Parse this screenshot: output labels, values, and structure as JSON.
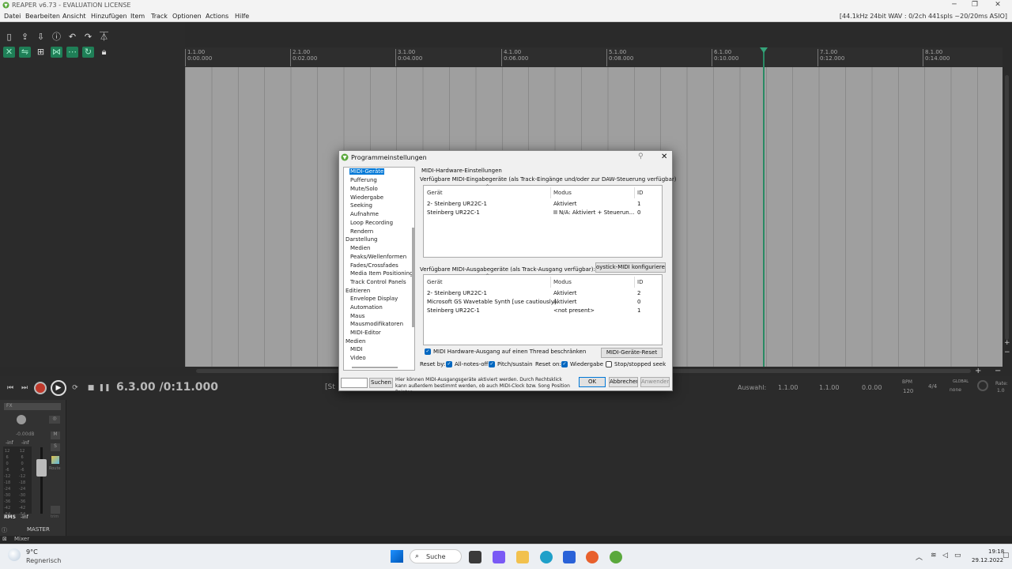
{
  "window": {
    "title": "REAPER v6.73 - EVALUATION LICENSE",
    "status": "[44.1kHz 24bit WAV : 0/2ch 441spls ~20/20ms ASIO]"
  },
  "menu": [
    "Datei",
    "Bearbeiten",
    "Ansicht",
    "Hinzufügen",
    "Item",
    "Track",
    "Optionen",
    "Actions",
    "Hilfe"
  ],
  "ruler": [
    {
      "bar": "1.1.00",
      "time": "0:00.000"
    },
    {
      "bar": "2.1.00",
      "time": "0:02.000"
    },
    {
      "bar": "3.1.00",
      "time": "0:04.000"
    },
    {
      "bar": "4.1.00",
      "time": "0:06.000"
    },
    {
      "bar": "5.1.00",
      "time": "0:08.000"
    },
    {
      "bar": "6.1.00",
      "time": "0:10.000"
    },
    {
      "bar": "7.1.00",
      "time": "0:12.000"
    },
    {
      "bar": "8.1.00",
      "time": "0:14.000"
    }
  ],
  "transport": {
    "position": "6.3.00 /0:11.000",
    "selection_label": "[St",
    "auswahl_label": "Auswahl:",
    "sel_start": "1.1.00",
    "sel_end": "1.1.00",
    "sel_len": "0.0.00",
    "bpm_label": "BPM",
    "bpm": "120",
    "sig": "4/4",
    "global_label": "GLOBAL",
    "global_value": "none",
    "rate_label": "Rate:",
    "rate": "1.0"
  },
  "master": {
    "fx": "FX",
    "vol": "-0.00dB",
    "peak_l": "-inf",
    "peak_r": "-inf",
    "rms": "RMS",
    "rms_val": "-inf",
    "m": "M",
    "s": "S",
    "route": "Route",
    "trim": "trim",
    "name": "MASTER",
    "scale": [
      "12",
      "6",
      "0",
      "-6",
      "-12",
      "-18",
      "-24",
      "-30",
      "-36",
      "-42",
      "-54"
    ]
  },
  "mixer_tab": "Mixer",
  "dialog": {
    "title": "Programmeinstellungen",
    "nav": [
      {
        "label": "MIDI-Geräte",
        "level": 1,
        "selected": true
      },
      {
        "label": "Pufferung",
        "level": 1
      },
      {
        "label": "Mute/Solo",
        "level": 1
      },
      {
        "label": "Wiedergabe",
        "level": 1
      },
      {
        "label": "Seeking",
        "level": 1
      },
      {
        "label": "Aufnahme",
        "level": 1
      },
      {
        "label": "Loop Recording",
        "level": 1
      },
      {
        "label": "Rendern",
        "level": 1
      },
      {
        "label": "Darstellung",
        "level": 0
      },
      {
        "label": "Medien",
        "level": 1
      },
      {
        "label": "Peaks/Wellenformen",
        "level": 1
      },
      {
        "label": "Fades/Crossfades",
        "level": 1
      },
      {
        "label": "Media Item Positioning",
        "level": 1
      },
      {
        "label": "Track Control Panels",
        "level": 1
      },
      {
        "label": "Editieren",
        "level": 0
      },
      {
        "label": "Envelope Display",
        "level": 1
      },
      {
        "label": "Automation",
        "level": 1
      },
      {
        "label": "Maus",
        "level": 1
      },
      {
        "label": "Mausmodifikatoren",
        "level": 1
      },
      {
        "label": "MIDI-Editor",
        "level": 1
      },
      {
        "label": "Medien",
        "level": 0
      },
      {
        "label": "MIDI",
        "level": 1
      },
      {
        "label": "Video",
        "level": 1
      }
    ],
    "section_title": "MIDI-Hardware-Einstellungen",
    "input_title": "Verfügbare MIDI-Eingabegeräte (als Track-Eingänge und/oder zur DAW-Steuerung verfügbar)",
    "output_title": "Verfügbare MIDI-Ausgabegeräte (als Track-Ausgang verfügbar):",
    "col_device": "Gerät",
    "col_mode": "Modus",
    "col_id": "ID",
    "inputs": [
      {
        "device": "2- Steinberg UR22C-1",
        "mode": "Aktiviert",
        "id": "1"
      },
      {
        "device": "Steinberg UR22C-1",
        "mode": "N/A: Aktiviert + Steuerun...",
        "id": "0"
      }
    ],
    "outputs": [
      {
        "device": "2- Steinberg UR22C-1",
        "mode": "Aktiviert",
        "id": "2"
      },
      {
        "device": "Microsoft GS Wavetable Synth [use cautiously]",
        "mode": "Aktiviert",
        "id": "0"
      },
      {
        "device": "Steinberg UR22C-1",
        "mode": "<not present>",
        "id": "1"
      }
    ],
    "joystick_button": "oystick-MIDI konfigurieren...",
    "thread_label": "MIDI Hardware-Ausgang auf einen Thread beschränken",
    "reset_button": "MIDI-Geräte-Reset",
    "reset_by": "Reset by:",
    "all_notes_off": "All-notes-off",
    "pitch_sustain": "Pitch/sustain",
    "reset_on": "Reset on:",
    "wiedergabe": "Wiedergabe",
    "stop_seek": "Stop/stopped seek",
    "search_button": "Suchen",
    "hint": "Hier können MIDI-Ausgangsgeräte aktiviert werden. Durch Rechtsklick kann außerdem bestimmt werden, ob auch MIDI-Clock bzw. Song Position Pointer",
    "ok": "OK",
    "cancel": "Abbrechen",
    "apply": "Anwenden"
  },
  "taskbar": {
    "temp": "9°C",
    "weather": "Regnerisch",
    "search": "Suche",
    "time": "19:18",
    "date": "29.12.2022"
  },
  "colors": {
    "accent": "#0078d7",
    "reaper_green": "#1f7f57",
    "cursor": "#2a8a64",
    "record": "#c0392b"
  }
}
